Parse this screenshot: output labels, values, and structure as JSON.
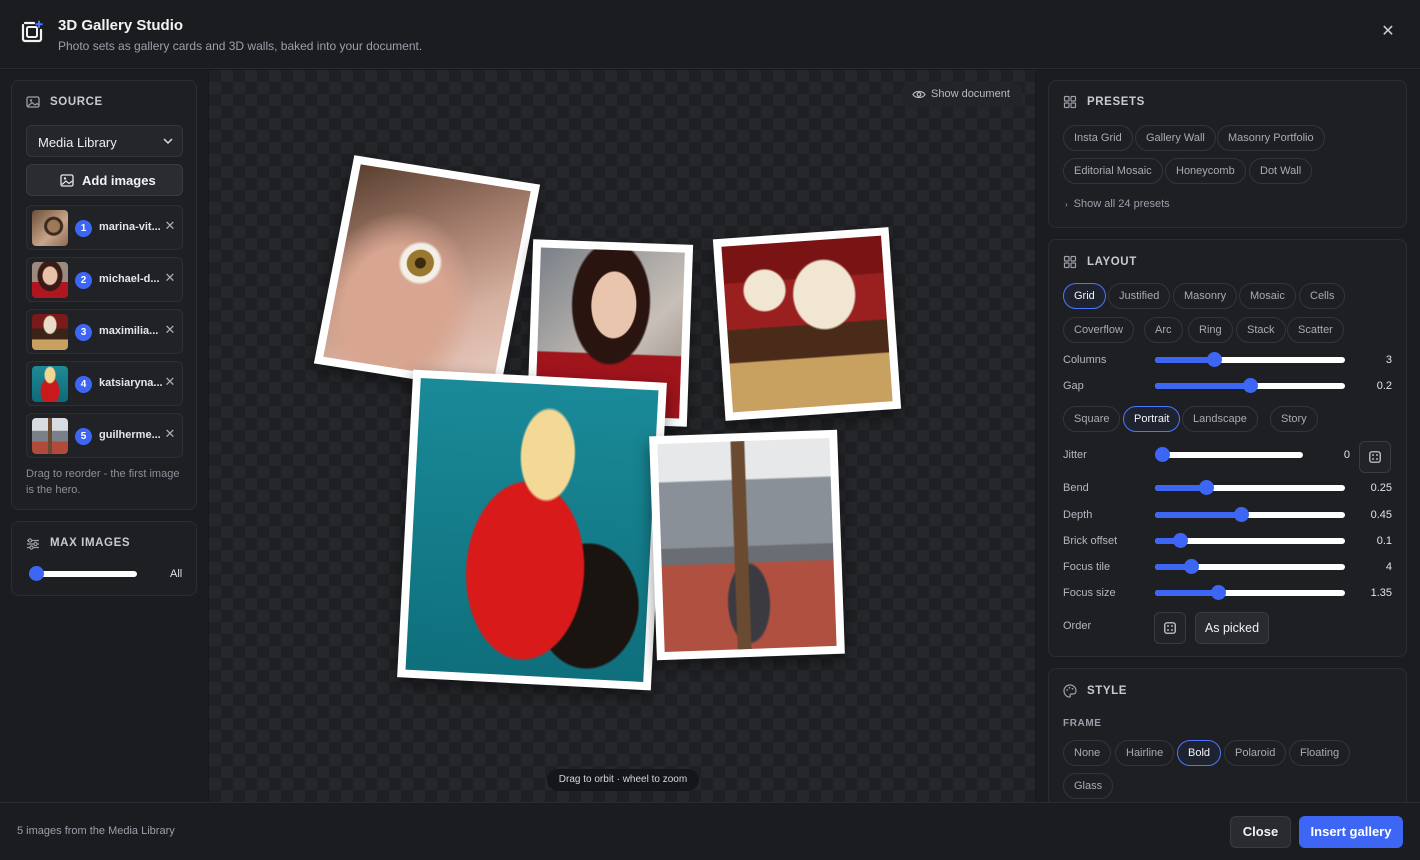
{
  "header": {
    "title": "3D Gallery Studio",
    "subtitle": "Photo sets as gallery cards and 3D walls, baked into your document.",
    "close": "✕"
  },
  "source": {
    "title": "SOURCE",
    "select_value": "Media Library",
    "add_label": "Add images",
    "images": [
      {
        "num": "1",
        "name": "marina-vit..."
      },
      {
        "num": "2",
        "name": "michael-d..."
      },
      {
        "num": "3",
        "name": "maximilia..."
      },
      {
        "num": "4",
        "name": "katsiaryna..."
      },
      {
        "num": "5",
        "name": "guilherme..."
      }
    ],
    "remove": "✕",
    "hint": "Drag to reorder - the first image is the hero."
  },
  "max_images": {
    "title": "MAX IMAGES",
    "value_label": "All",
    "level": 0
  },
  "canvas": {
    "show_document": "Show document",
    "orbit_hint": "Drag to orbit · wheel to zoom"
  },
  "presets": {
    "title": "PRESETS",
    "items": [
      "Insta Grid",
      "Gallery Wall",
      "Masonry Portfolio",
      "Editorial Mosaic",
      "Honeycomb",
      "Dot Wall"
    ],
    "show_all": "Show all 24 presets"
  },
  "layout": {
    "title": "LAYOUT",
    "modes": [
      "Grid",
      "Justified",
      "Masonry",
      "Mosaic",
      "Cells",
      "Coverflow",
      "Arc",
      "Ring",
      "Stack",
      "Scatter"
    ],
    "active_mode": "Grid",
    "aspects": [
      "Square",
      "Portrait",
      "Landscape",
      "Story"
    ],
    "active_aspect": "Portrait",
    "sliders": {
      "columns": {
        "label": "Columns",
        "value": "3",
        "fraction": 0.31
      },
      "gap": {
        "label": "Gap",
        "value": "0.2",
        "fraction": 0.5
      },
      "jitter": {
        "label": "Jitter",
        "value": "0",
        "fraction": 0.0
      },
      "bend": {
        "label": "Bend",
        "value": "0.25",
        "fraction": 0.27
      },
      "depth": {
        "label": "Depth",
        "value": "0.45",
        "fraction": 0.45
      },
      "brick": {
        "label": "Brick offset",
        "value": "0.1",
        "fraction": 0.13
      },
      "focus_tile": {
        "label": "Focus tile",
        "value": "4",
        "fraction": 0.19
      },
      "focus_size": {
        "label": "Focus size",
        "value": "1.35",
        "fraction": 0.33
      }
    },
    "order_label": "Order",
    "order_value": "As picked"
  },
  "style": {
    "title": "STYLE",
    "frame_label": "FRAME",
    "frames": [
      "None",
      "Hairline",
      "Bold",
      "Polaroid",
      "Floating",
      "Glass"
    ],
    "active_frame": "Bold"
  },
  "footer": {
    "status": "5 images from the Media Library",
    "close": "Close",
    "insert": "Insert gallery"
  },
  "colors": {
    "accent": "#3d66f5",
    "background": "#17181b",
    "panel": "#1e1f23"
  }
}
